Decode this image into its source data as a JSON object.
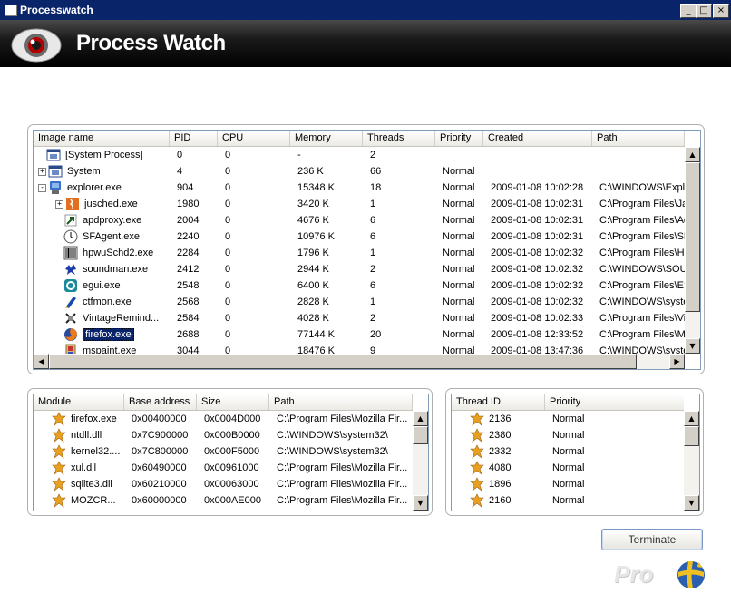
{
  "window": {
    "title": "Processwatch"
  },
  "header": {
    "title": "Process Watch"
  },
  "process_list": {
    "columns": [
      "Image name",
      "PID",
      "CPU",
      "Memory",
      "Threads",
      "Priority",
      "Created",
      "Path"
    ],
    "rows": [
      {
        "name": "[System Process]",
        "pid": "0",
        "cpu": "0",
        "memory": "-",
        "threads": "2",
        "priority": "",
        "created": "",
        "path": "",
        "expander": "",
        "icon": "system-process-icon",
        "selected": false
      },
      {
        "name": "System",
        "pid": "4",
        "cpu": "0",
        "memory": "236 K",
        "threads": "66",
        "priority": "Normal",
        "created": "",
        "path": "",
        "expander": "+",
        "icon": "system-icon",
        "selected": false
      },
      {
        "name": "explorer.exe",
        "pid": "904",
        "cpu": "0",
        "memory": "15348 K",
        "threads": "18",
        "priority": "Normal",
        "created": "2009-01-08 10:02:28",
        "path": "C:\\WINDOWS\\Explo",
        "expander": "-",
        "icon": "explorer-icon",
        "selected": false
      },
      {
        "name": "jusched.exe",
        "pid": "1980",
        "cpu": "0",
        "memory": "3420 K",
        "threads": "1",
        "priority": "Normal",
        "created": "2009-01-08 10:02:31",
        "path": "C:\\Program Files\\Java",
        "expander": "+",
        "icon": "java-icon",
        "selected": false
      },
      {
        "name": "apdproxy.exe",
        "pid": "2004",
        "cpu": "0",
        "memory": "4676 K",
        "threads": "6",
        "priority": "Normal",
        "created": "2009-01-08 10:02:31",
        "path": "C:\\Program Files\\Ado",
        "expander": "",
        "icon": "shortcut-arrow-icon",
        "selected": false
      },
      {
        "name": "SFAgent.exe",
        "pid": "2240",
        "cpu": "0",
        "memory": "10976 K",
        "threads": "6",
        "priority": "Normal",
        "created": "2009-01-08 10:02:31",
        "path": "C:\\Program Files\\SPA",
        "expander": "",
        "icon": "clock-icon",
        "selected": false
      },
      {
        "name": "hpwuSchd2.exe",
        "pid": "2284",
        "cpu": "0",
        "memory": "1796 K",
        "threads": "1",
        "priority": "Normal",
        "created": "2009-01-08 10:02:32",
        "path": "C:\\Program Files\\Hp\\",
        "expander": "",
        "icon": "barcode-icon",
        "selected": false
      },
      {
        "name": "soundman.exe",
        "pid": "2412",
        "cpu": "0",
        "memory": "2944 K",
        "threads": "2",
        "priority": "Normal",
        "created": "2009-01-08 10:02:32",
        "path": "C:\\WINDOWS\\SOUN",
        "expander": "",
        "icon": "sound-icon",
        "selected": false
      },
      {
        "name": "egui.exe",
        "pid": "2548",
        "cpu": "0",
        "memory": "6400 K",
        "threads": "6",
        "priority": "Normal",
        "created": "2009-01-08 10:02:32",
        "path": "C:\\Program Files\\ESE",
        "expander": "",
        "icon": "eset-icon",
        "selected": false
      },
      {
        "name": "ctfmon.exe",
        "pid": "2568",
        "cpu": "0",
        "memory": "2828 K",
        "threads": "1",
        "priority": "Normal",
        "created": "2009-01-08 10:02:32",
        "path": "C:\\WINDOWS\\syster",
        "expander": "",
        "icon": "ctfmon-icon",
        "selected": false
      },
      {
        "name": "VintageRemind...",
        "pid": "2584",
        "cpu": "0",
        "memory": "4028 K",
        "threads": "2",
        "priority": "Normal",
        "created": "2009-01-08 10:02:33",
        "path": "C:\\Program Files\\Vine",
        "expander": "",
        "icon": "vintage-icon",
        "selected": false
      },
      {
        "name": "firefox.exe",
        "pid": "2688",
        "cpu": "0",
        "memory": "77144 K",
        "threads": "20",
        "priority": "Normal",
        "created": "2009-01-08 12:33:52",
        "path": "C:\\Program Files\\Moz",
        "expander": "",
        "icon": "firefox-icon",
        "selected": true
      },
      {
        "name": "mspaint.exe",
        "pid": "3044",
        "cpu": "0",
        "memory": "18476 K",
        "threads": "9",
        "priority": "Normal",
        "created": "2009-01-08 13:47:36",
        "path": "C:\\WINDOWS\\syster",
        "expander": "",
        "icon": "paint-icon",
        "selected": false
      }
    ]
  },
  "module_list": {
    "columns": [
      "Module",
      "Base address",
      "Size",
      "Path"
    ],
    "rows": [
      {
        "module": "firefox.exe",
        "base": "0x00400000",
        "size": "0x0004D000",
        "path": "C:\\Program Files\\Mozilla Fir..."
      },
      {
        "module": "ntdll.dll",
        "base": "0x7C900000",
        "size": "0x000B0000",
        "path": "C:\\WINDOWS\\system32\\"
      },
      {
        "module": "kernel32....",
        "base": "0x7C800000",
        "size": "0x000F5000",
        "path": "C:\\WINDOWS\\system32\\"
      },
      {
        "module": "xul.dll",
        "base": "0x60490000",
        "size": "0x00961000",
        "path": "C:\\Program Files\\Mozilla Fir..."
      },
      {
        "module": "sqlite3.dll",
        "base": "0x60210000",
        "size": "0x00063000",
        "path": "C:\\Program Files\\Mozilla Fir..."
      },
      {
        "module": "MOZCR...",
        "base": "0x60000000",
        "size": "0x000AE000",
        "path": "C:\\Program Files\\Mozilla Fir..."
      }
    ]
  },
  "thread_list": {
    "columns": [
      "Thread ID",
      "Priority"
    ],
    "rows": [
      {
        "id": "2136",
        "priority": "Normal"
      },
      {
        "id": "2380",
        "priority": "Normal"
      },
      {
        "id": "2332",
        "priority": "Normal"
      },
      {
        "id": "4080",
        "priority": "Normal"
      },
      {
        "id": "1896",
        "priority": "Normal"
      },
      {
        "id": "2160",
        "priority": "Normal"
      }
    ]
  },
  "actions": {
    "terminate": "Terminate"
  },
  "branding": {
    "edition": "Pro"
  }
}
